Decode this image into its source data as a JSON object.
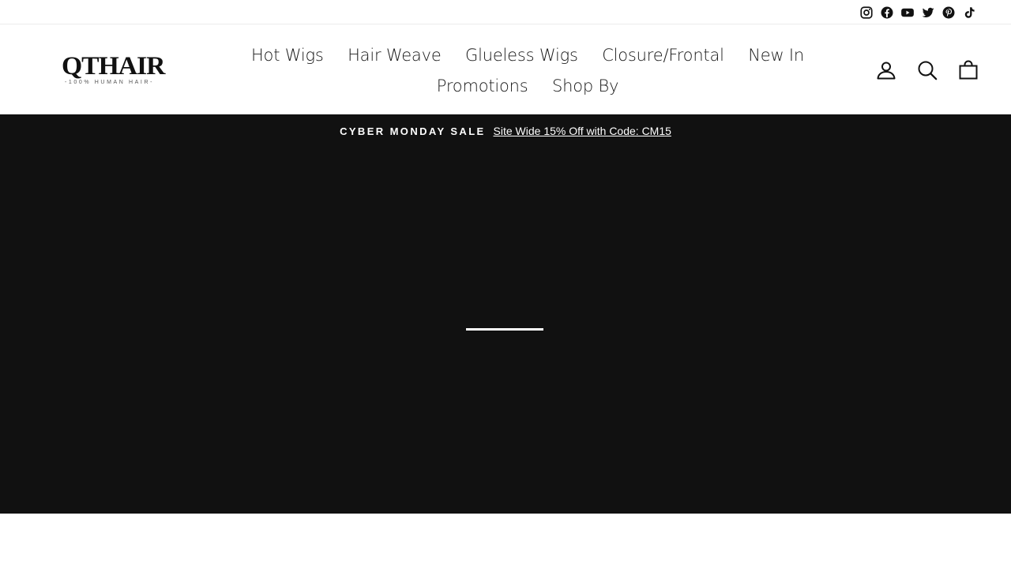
{
  "social": [
    {
      "name": "instagram-icon"
    },
    {
      "name": "facebook-icon"
    },
    {
      "name": "youtube-icon"
    },
    {
      "name": "twitter-icon"
    },
    {
      "name": "pinterest-icon"
    },
    {
      "name": "tiktok-icon"
    }
  ],
  "logo": {
    "word": "QTHAIR",
    "tagline": "-100% HUMAN HAIR-"
  },
  "nav": {
    "items": [
      "Hot Wigs",
      "Hair Weave",
      "Glueless Wigs",
      "Closure/Frontal",
      "New In",
      "Promotions",
      "Shop By"
    ]
  },
  "header_icons": [
    "account-icon",
    "search-icon",
    "cart-icon"
  ],
  "announcement": {
    "sale_label": "CYBER MONDAY SALE",
    "promo_text": "Site Wide 15% Off with Code: CM15"
  },
  "colors": {
    "hero_background": "#111111",
    "text": "#111111",
    "accent": "#ffffff"
  }
}
